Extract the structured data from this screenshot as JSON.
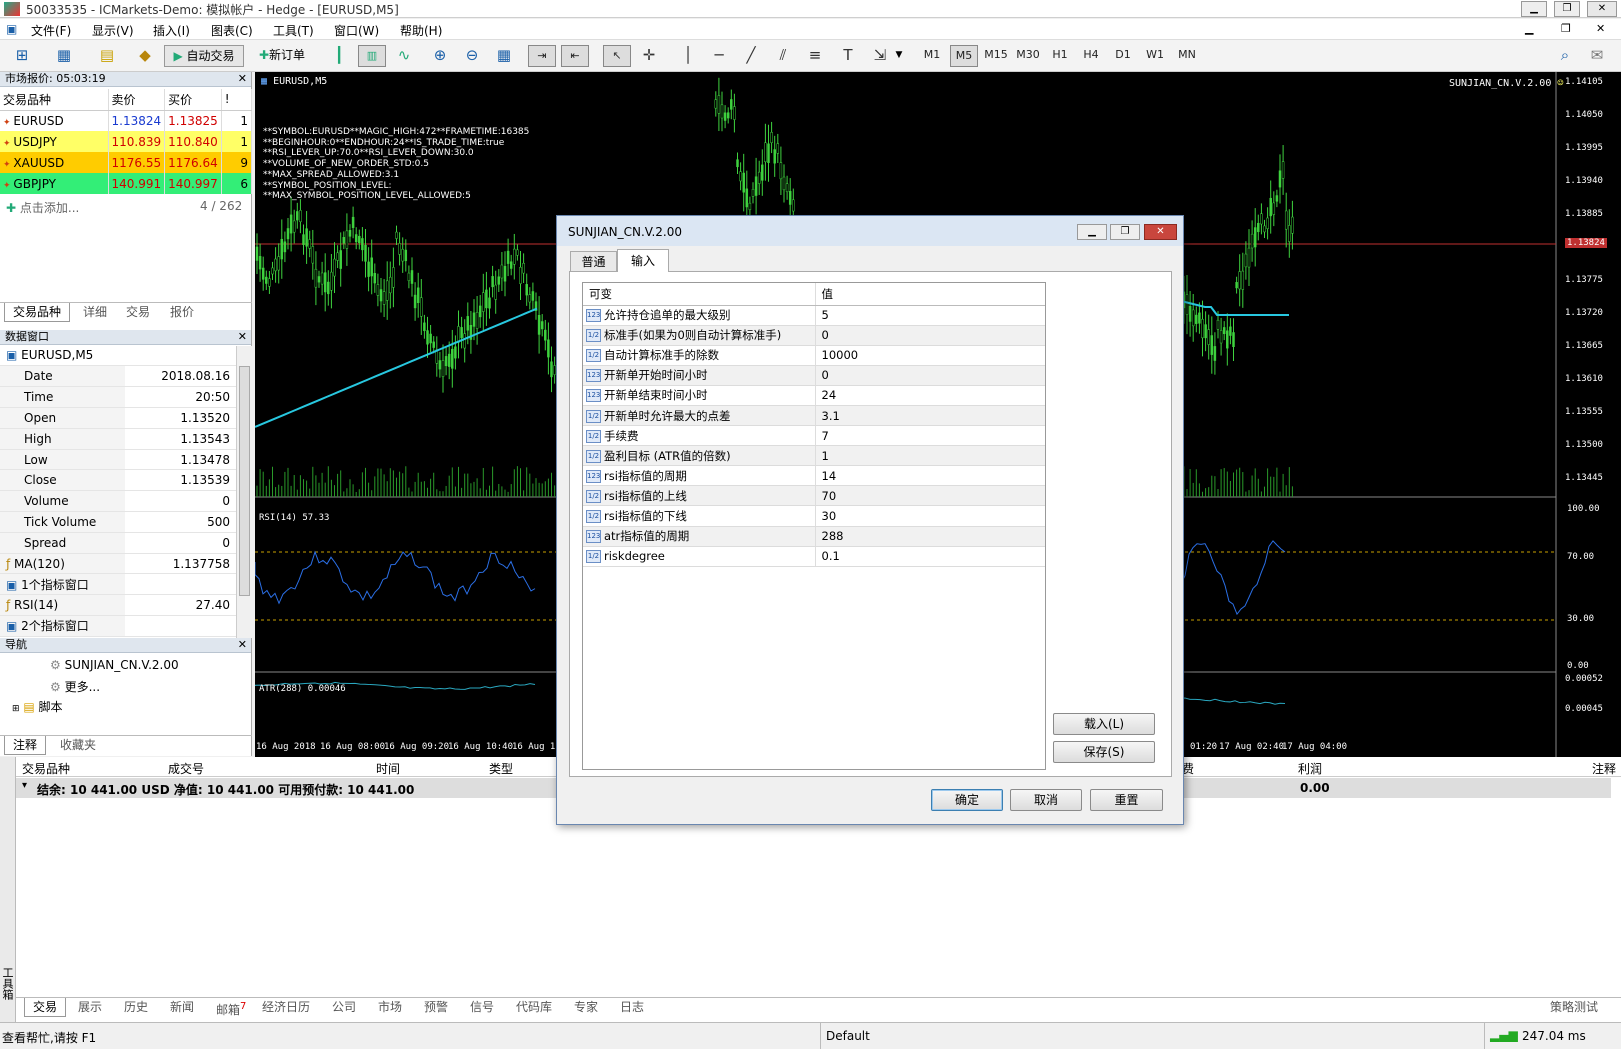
{
  "window": {
    "title": "50033535 - ICMarkets-Demo: 模拟帐户 - Hedge - [EURUSD,M5]"
  },
  "menu": [
    "文件(F)",
    "显示(V)",
    "插入(I)",
    "图表(C)",
    "工具(T)",
    "窗口(W)",
    "帮助(H)"
  ],
  "toolbar": {
    "autotrade": "自动交易",
    "new_order": "新订单",
    "timeframes": [
      "M1",
      "M5",
      "M15",
      "M30",
      "H1",
      "H4",
      "D1",
      "W1",
      "MN"
    ],
    "active_tf": "M5"
  },
  "market": {
    "title": "市场报价: 05:03:19",
    "headers": [
      "交易品种",
      "卖价",
      "买价",
      "!"
    ],
    "rows": [
      {
        "symbol": "EURUSD",
        "bid": "1.13824",
        "ask": "1.13825",
        "n": "1",
        "bg": "#ffffff"
      },
      {
        "symbol": "USDJPY",
        "bid": "110.839",
        "ask": "110.840",
        "n": "1",
        "bg": "#ffff66"
      },
      {
        "symbol": "XAUUSD",
        "bid": "1176.55",
        "ask": "1176.64",
        "n": "9",
        "bg": "#ffcc00"
      },
      {
        "symbol": "GBPJPY",
        "bid": "140.991",
        "ask": "140.997",
        "n": "6",
        "bg": "#33ee77"
      }
    ],
    "add": "点击添加...",
    "count": "4 / 262",
    "tabs": [
      "交易品种",
      "详细",
      "交易",
      "报价"
    ]
  },
  "datawin": {
    "title": "数据窗口",
    "symbol": "EURUSD,M5",
    "rows": [
      [
        "Date",
        "2018.08.16"
      ],
      [
        "Time",
        "20:50"
      ],
      [
        "Open",
        "1.13520"
      ],
      [
        "High",
        "1.13543"
      ],
      [
        "Low",
        "1.13478"
      ],
      [
        "Close",
        "1.13539"
      ],
      [
        "Volume",
        "0"
      ],
      [
        "Tick Volume",
        "500"
      ],
      [
        "Spread",
        "0"
      ],
      [
        "MA(120)",
        "1.137758"
      ],
      [
        "1个指标窗口",
        ""
      ],
      [
        "RSI(14)",
        "27.40"
      ],
      [
        "2个指标窗口",
        ""
      ]
    ]
  },
  "nav": {
    "title": "导航",
    "items": [
      "SUNJIAN_CN.V.2.00",
      "更多...",
      "脚本"
    ],
    "tabs": [
      "注释",
      "收藏夹"
    ]
  },
  "chart": {
    "symbol": "EURUSD,M5",
    "ea": "SUNJIAN_CN.V.2.00",
    "overlay": [
      "**SYMBOL:EURUSD**MAGIC_HIGH:472**FRAMETIME:16385",
      "**BEGINHOUR:0**ENDHOUR:24**IS_TRADE_TIME:true",
      "**RSI_LEVER_UP:70.0**RSI_LEVER_DOWN:30.0",
      "**VOLUME_OF_NEW_ORDER_STD:0.5",
      "**MAX_SPREAD_ALLOWED:3.1",
      "**SYMBOL_POSITION_LEVEL:",
      "**MAX_SYMBOL_POSITION_LEVEL_ALLOWED:5"
    ],
    "prices": [
      "1.14105",
      "1.14050",
      "1.13995",
      "1.13940",
      "1.13885",
      "1.13824",
      "1.13775",
      "1.13720",
      "1.13665",
      "1.13610",
      "1.13555",
      "1.13500",
      "1.13445"
    ],
    "rsi_label": "RSI(14) 57.33",
    "rsi_levels": [
      "100.00",
      "70.00",
      "30.00",
      "0.00"
    ],
    "atr_label": "ATR(288) 0.00046",
    "atr_levels": [
      "0.00052",
      "0.00045"
    ],
    "times_left": [
      "16 Aug 2018",
      "16 Aug 08:00",
      "16 Aug 09:20",
      "16 Aug 10:40",
      "16 Aug 12"
    ],
    "times_right": [
      "01:20",
      "17 Aug 02:40",
      "17 Aug 04:00"
    ],
    "bid_color": "#c03030"
  },
  "terminal": {
    "headers": [
      "交易品种",
      "成交号",
      "时间",
      "类型",
      "费",
      "利润",
      "注释"
    ],
    "balance": "结余: 10 441.00 USD  净值: 10 441.00  可用预付款: 10 441.00",
    "profit": "0.00",
    "side": "工具箱",
    "tabs": [
      "交易",
      "展示",
      "历史",
      "新闻",
      "邮箱",
      "经济日历",
      "公司",
      "市场",
      "预警",
      "信号",
      "代码库",
      "专家",
      "日志"
    ],
    "mail_count": "7",
    "strategy": "策略测试"
  },
  "status": {
    "help": "查看帮忙,请按 F1",
    "profile": "Default",
    "ping": "247.04 ms"
  },
  "dialog": {
    "title": "SUNJIAN_CN.V.2.00",
    "tabs": [
      "普通",
      "输入"
    ],
    "headers": [
      "可变",
      "值"
    ],
    "params": [
      {
        "type": "123",
        "name": "允许持仓追单的最大级别",
        "value": "5"
      },
      {
        "type": "1/2",
        "name": "标准手(如果为0则自动计算标准手)",
        "value": "0"
      },
      {
        "type": "1/2",
        "name": "自动计算标准手的除数",
        "value": "10000"
      },
      {
        "type": "123",
        "name": "开新单开始时间小时",
        "value": "0"
      },
      {
        "type": "123",
        "name": "开新单结束时间小时",
        "value": "24"
      },
      {
        "type": "1/2",
        "name": "开新单时允许最大的点差",
        "value": "3.1"
      },
      {
        "type": "1/2",
        "name": "手续费",
        "value": "7"
      },
      {
        "type": "1/2",
        "name": "盈利目标 (ATR值的倍数)",
        "value": "1"
      },
      {
        "type": "123",
        "name": "rsi指标值的周期",
        "value": "14"
      },
      {
        "type": "1/2",
        "name": "rsi指标值的上线",
        "value": "70"
      },
      {
        "type": "1/2",
        "name": "rsi指标值的下线",
        "value": "30"
      },
      {
        "type": "123",
        "name": "atr指标值的周期",
        "value": "288"
      },
      {
        "type": "1/2",
        "name": "riskdegree",
        "value": "0.1"
      }
    ],
    "load": "载入(L)",
    "save": "保存(S)",
    "ok": "确定",
    "cancel": "取消",
    "reset": "重置"
  }
}
